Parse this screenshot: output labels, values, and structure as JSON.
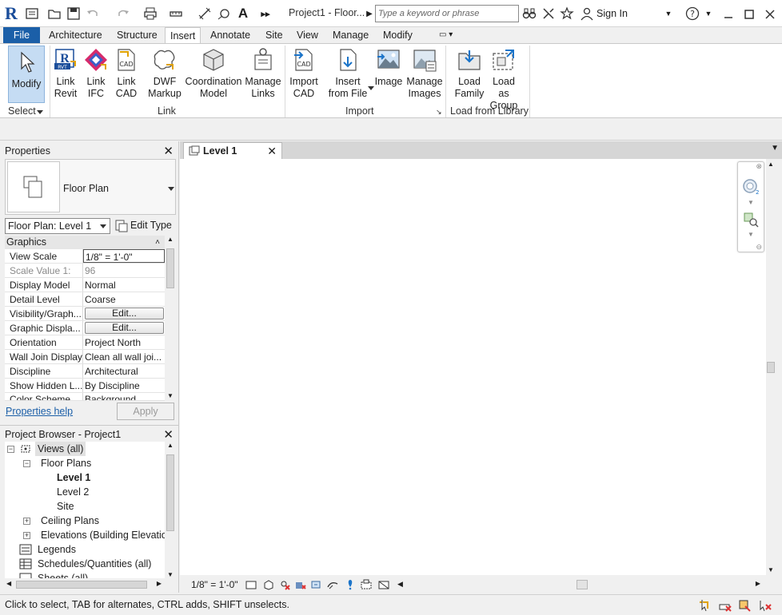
{
  "titlebar": {
    "logo": "R",
    "title": "Project1 - Floor...",
    "search_placeholder": "Type a keyword or phrase",
    "signin": "Sign In"
  },
  "menu_tabs": [
    "File",
    "Architecture",
    "Structure",
    "Insert",
    "Annotate",
    "Site",
    "View",
    "Manage",
    "Modify"
  ],
  "active_tab": "Insert",
  "ribbon": {
    "select": {
      "modify": "Modify",
      "panel": "Select"
    },
    "link": {
      "panel": "Link",
      "buttons": [
        {
          "line1": "Link",
          "line2": "Revit"
        },
        {
          "line1": "Link",
          "line2": "IFC"
        },
        {
          "line1": "Link",
          "line2": "CAD"
        },
        {
          "line1": "DWF",
          "line2": "Markup"
        },
        {
          "line1": "Coordination",
          "line2": "Model"
        },
        {
          "line1": "Manage",
          "line2": "Links"
        }
      ]
    },
    "import": {
      "panel": "Import",
      "buttons": [
        {
          "line1": "Import",
          "line2": "CAD"
        },
        {
          "line1": "Insert",
          "line2": "from File"
        },
        {
          "line1": "Image",
          "line2": ""
        },
        {
          "line1": "Manage",
          "line2": "Images"
        }
      ]
    },
    "load": {
      "panel": "Load from Library",
      "buttons": [
        {
          "line1": "Load",
          "line2": "Family"
        },
        {
          "line1": "Load as",
          "line2": "Group"
        }
      ]
    }
  },
  "properties": {
    "title": "Properties",
    "type_name": "Floor Plan",
    "instance": "Floor Plan: Level 1",
    "edit_type": "Edit Type",
    "category": "Graphics",
    "rows": [
      {
        "name": "View Scale",
        "value": "1/8\" = 1'-0\""
      },
      {
        "name": "Scale Value    1:",
        "value": "96"
      },
      {
        "name": "Display Model",
        "value": "Normal"
      },
      {
        "name": "Detail Level",
        "value": "Coarse"
      },
      {
        "name": "Visibility/Graph...",
        "value": "Edit..."
      },
      {
        "name": "Graphic Displa...",
        "value": "Edit..."
      },
      {
        "name": "Orientation",
        "value": "Project North"
      },
      {
        "name": "Wall Join Display",
        "value": "Clean all wall joi..."
      },
      {
        "name": "Discipline",
        "value": "Architectural"
      },
      {
        "name": "Show Hidden L...",
        "value": "By Discipline"
      },
      {
        "name": "Color Scheme...",
        "value": "Background"
      }
    ],
    "help": "Properties help",
    "apply": "Apply"
  },
  "browser": {
    "title": "Project Browser - Project1",
    "nodes": {
      "views": "Views (all)",
      "floor_plans": "Floor Plans",
      "level1": "Level 1",
      "level2": "Level 2",
      "site": "Site",
      "ceiling_plans": "Ceiling Plans",
      "elevations": "Elevations (Building Elevation",
      "legends": "Legends",
      "schedules": "Schedules/Quantities (all)",
      "sheets": "Sheets (all)"
    }
  },
  "view_tab": "Level 1",
  "view_scale": "1/8\" = 1'-0\"",
  "status": "Click to select, TAB for alternates, CTRL adds, SHIFT unselects."
}
